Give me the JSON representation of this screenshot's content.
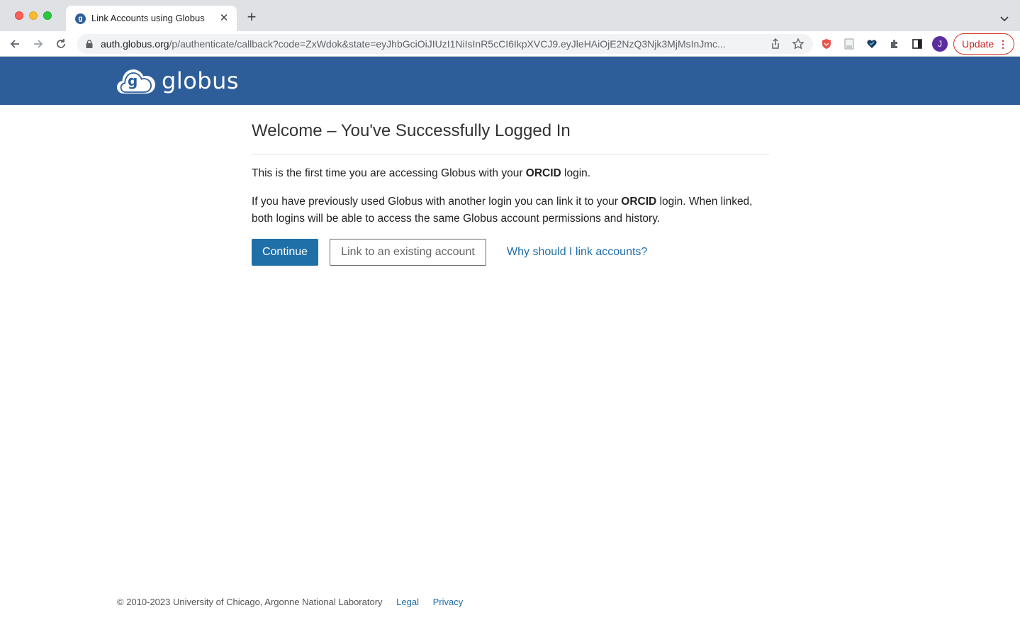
{
  "browser": {
    "tab_title": "Link Accounts using Globus",
    "url_host": "auth.globus.org",
    "url_rest": "/p/authenticate/callback?code=ZxWdok&state=eyJhbGciOiJIUzI1NiIsInR5cCI6IkpXVCJ9.eyJleHAiOjE2NzQ3Njk3MjMsInJmc...",
    "profile_initial": "J",
    "update_label": "Update",
    "icons": [
      "back-icon",
      "forward-icon",
      "reload-icon",
      "lock-icon",
      "share-icon",
      "star-icon",
      "shield-icon",
      "document-icon",
      "heart-icon",
      "puzzle-icon",
      "sidepanel-icon",
      "menu-dots-icon"
    ]
  },
  "header": {
    "logo_text": "globus"
  },
  "main": {
    "title": "Welcome – You've Successfully Logged In",
    "p1_before": "This is the first time you are accessing Globus with your ",
    "p1_bold": "ORCID",
    "p1_after": " login.",
    "p2_before": "If you have previously used Globus with another login you can link it to your ",
    "p2_bold": "ORCID",
    "p2_after": " login. When linked, both logins will be able to access the same Globus account permissions and history.",
    "continue_label": "Continue",
    "link_account_label": "Link to an existing account",
    "why_link_label": "Why should I link accounts?"
  },
  "footer": {
    "copyright": "© 2010-2023 University of Chicago, Argonne National Laboratory",
    "legal": "Legal",
    "privacy": "Privacy"
  },
  "colors": {
    "brand_blue": "#2e5e9a",
    "button_blue": "#1f6fa8",
    "update_red": "#d93025"
  }
}
